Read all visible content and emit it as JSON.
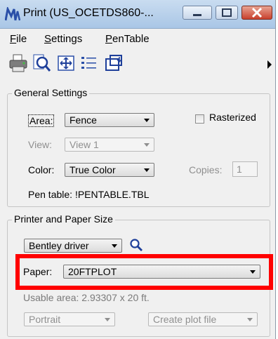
{
  "window": {
    "title": "Print  (US_OCETDS860-...",
    "minimize_label": "minimize",
    "maximize_label": "maximize",
    "close_label": "close"
  },
  "menu": [
    {
      "label": "File"
    },
    {
      "label": "Settings"
    },
    {
      "label": "PenTable"
    }
  ],
  "toolbar": {
    "icons": [
      "printer-icon",
      "preview-icon",
      "maximize-icon",
      "list-icon",
      "fence-icon"
    ]
  },
  "general": {
    "title": "General Settings",
    "area_label": "Area:",
    "area_value": "Fence",
    "rasterized_label": "Rasterized",
    "rasterized_checked": false,
    "view_label": "View:",
    "view_value": "View 1",
    "color_label": "Color:",
    "color_value": "True Color",
    "copies_label": "Copies:",
    "copies_value": "1",
    "pen_table_text": "Pen table:  !PENTABLE.TBL"
  },
  "printer": {
    "title": "Printer and Paper Size",
    "driver_value": "Bentley driver",
    "paper_label": "Paper:",
    "paper_value": "20FTPLOT",
    "usable_area_text": "Usable area:  2.93307 x 20 ft.",
    "orientation_value": "Portrait",
    "output_value": "Create plot file"
  },
  "highlight_color": "#ff0000"
}
